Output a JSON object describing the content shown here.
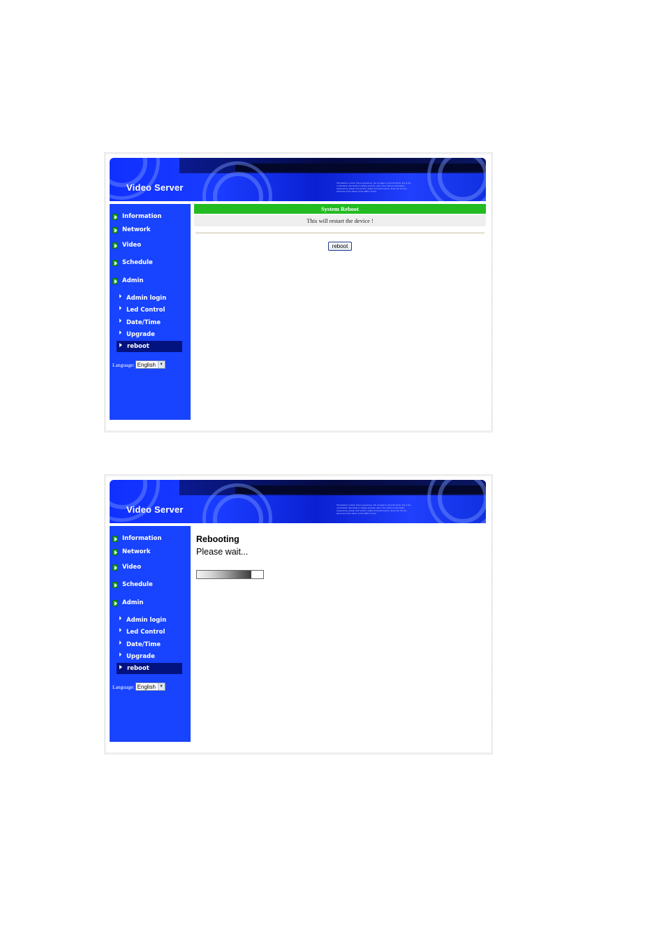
{
  "header": {
    "title": "Video Server",
    "fine_text": "Tarnsdeliver a vision fromo experience, the courage to push the limits, this is the combination that leads to making success, also in the world of automation engineering, design and comfort, safety and performance, these are the key elements of the values of the M86 in Snore."
  },
  "sidebar": {
    "items": [
      {
        "label": "Information"
      },
      {
        "label": "Network"
      },
      {
        "label": "Video"
      },
      {
        "label": "Schedule"
      },
      {
        "label": "Admin"
      }
    ],
    "subitems": [
      {
        "label": "Admin login"
      },
      {
        "label": "Led Control"
      },
      {
        "label": "Date/Time"
      },
      {
        "label": "Upgrade"
      },
      {
        "label": "reboot",
        "active": true
      }
    ],
    "language_label": "Language:",
    "language_value": "English"
  },
  "reboot_page": {
    "header": "System Reboot",
    "description": "This will restart the device !",
    "button_label": "reboot"
  },
  "rebooting_page": {
    "title": "Rebooting",
    "message": "Please wait...",
    "progress_fraction": 0.82
  },
  "colors": {
    "sidebar_bg": "#1843ff",
    "active_item_bg": "#02127e",
    "header_green": "#22bb22"
  }
}
